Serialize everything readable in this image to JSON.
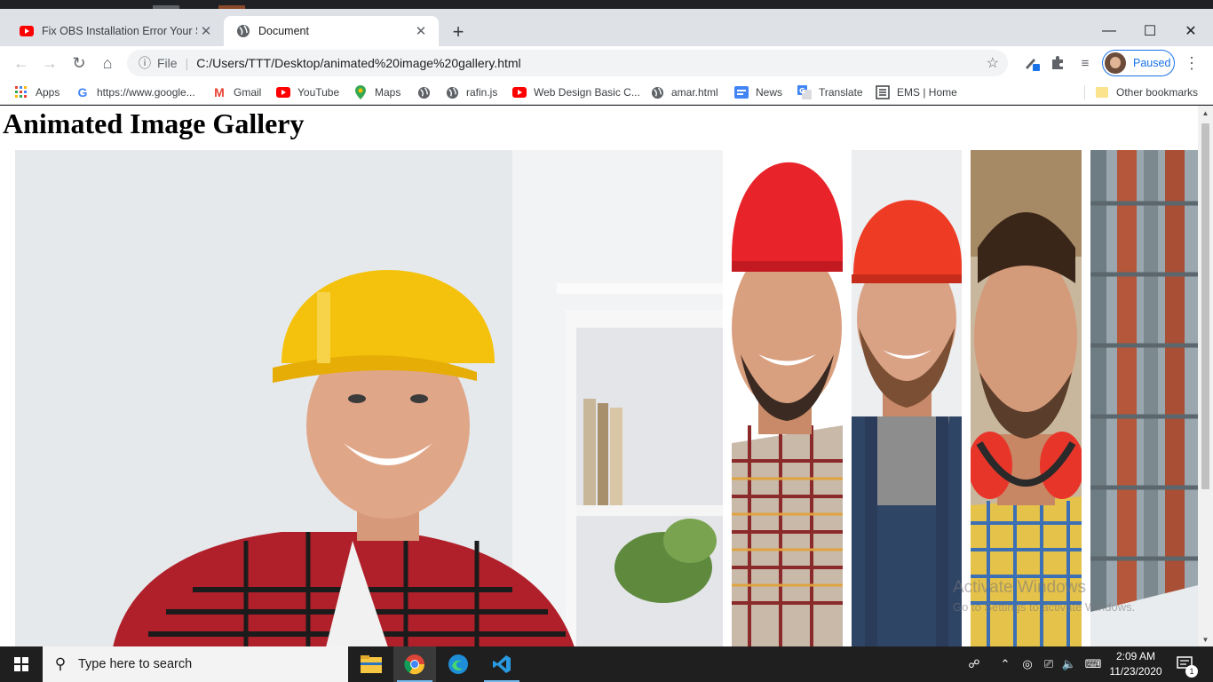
{
  "browser": {
    "tabs": [
      {
        "title": "Fix OBS Installation Error Your Sy",
        "icon": "youtube-icon"
      },
      {
        "title": "Document",
        "icon": "globe-icon"
      }
    ],
    "address": {
      "scheme": "File",
      "url": "C:/Users/TTT/Desktop/animated%20image%20gallery.html"
    },
    "profile_status": "Paused",
    "bookmarks": [
      {
        "label": "Apps",
        "icon": "apps-grid-icon"
      },
      {
        "label": "https://www.google...",
        "icon": "google-icon"
      },
      {
        "label": "Gmail",
        "icon": "gmail-icon"
      },
      {
        "label": "YouTube",
        "icon": "youtube-icon"
      },
      {
        "label": "Maps",
        "icon": "maps-pin-icon"
      },
      {
        "label": "",
        "icon": "globe-icon"
      },
      {
        "label": "rafin.js",
        "icon": "globe-icon"
      },
      {
        "label": "Web Design Basic C...",
        "icon": "youtube-icon"
      },
      {
        "label": "amar.html",
        "icon": "globe-icon"
      },
      {
        "label": "News",
        "icon": "google-news-icon"
      },
      {
        "label": "Translate",
        "icon": "google-translate-icon"
      },
      {
        "label": "EMS | Home",
        "icon": "ems-icon"
      }
    ],
    "other_bookmarks": "Other bookmarks"
  },
  "page": {
    "heading": "Animated Image Gallery",
    "images": [
      {
        "name": "older-worker-yellow-helmet"
      },
      {
        "name": "young-worker-red-helmet"
      },
      {
        "name": "bearded-worker-red-helmet"
      },
      {
        "name": "worker-ear-protectors"
      },
      {
        "name": "building-facade-photo"
      }
    ]
  },
  "watermark": {
    "title": "Activate Windows",
    "subtitle": "Go to Settings to activate Windows."
  },
  "taskbar": {
    "search_placeholder": "Type here to search",
    "time": "2:09 AM",
    "date": "11/23/2020",
    "notification_count": "1"
  },
  "colors": {
    "tab_strip": "#dee1e6",
    "accent": "#1a73e8",
    "taskbar": "#1f1f1f",
    "youtube_red": "#ff0000"
  }
}
